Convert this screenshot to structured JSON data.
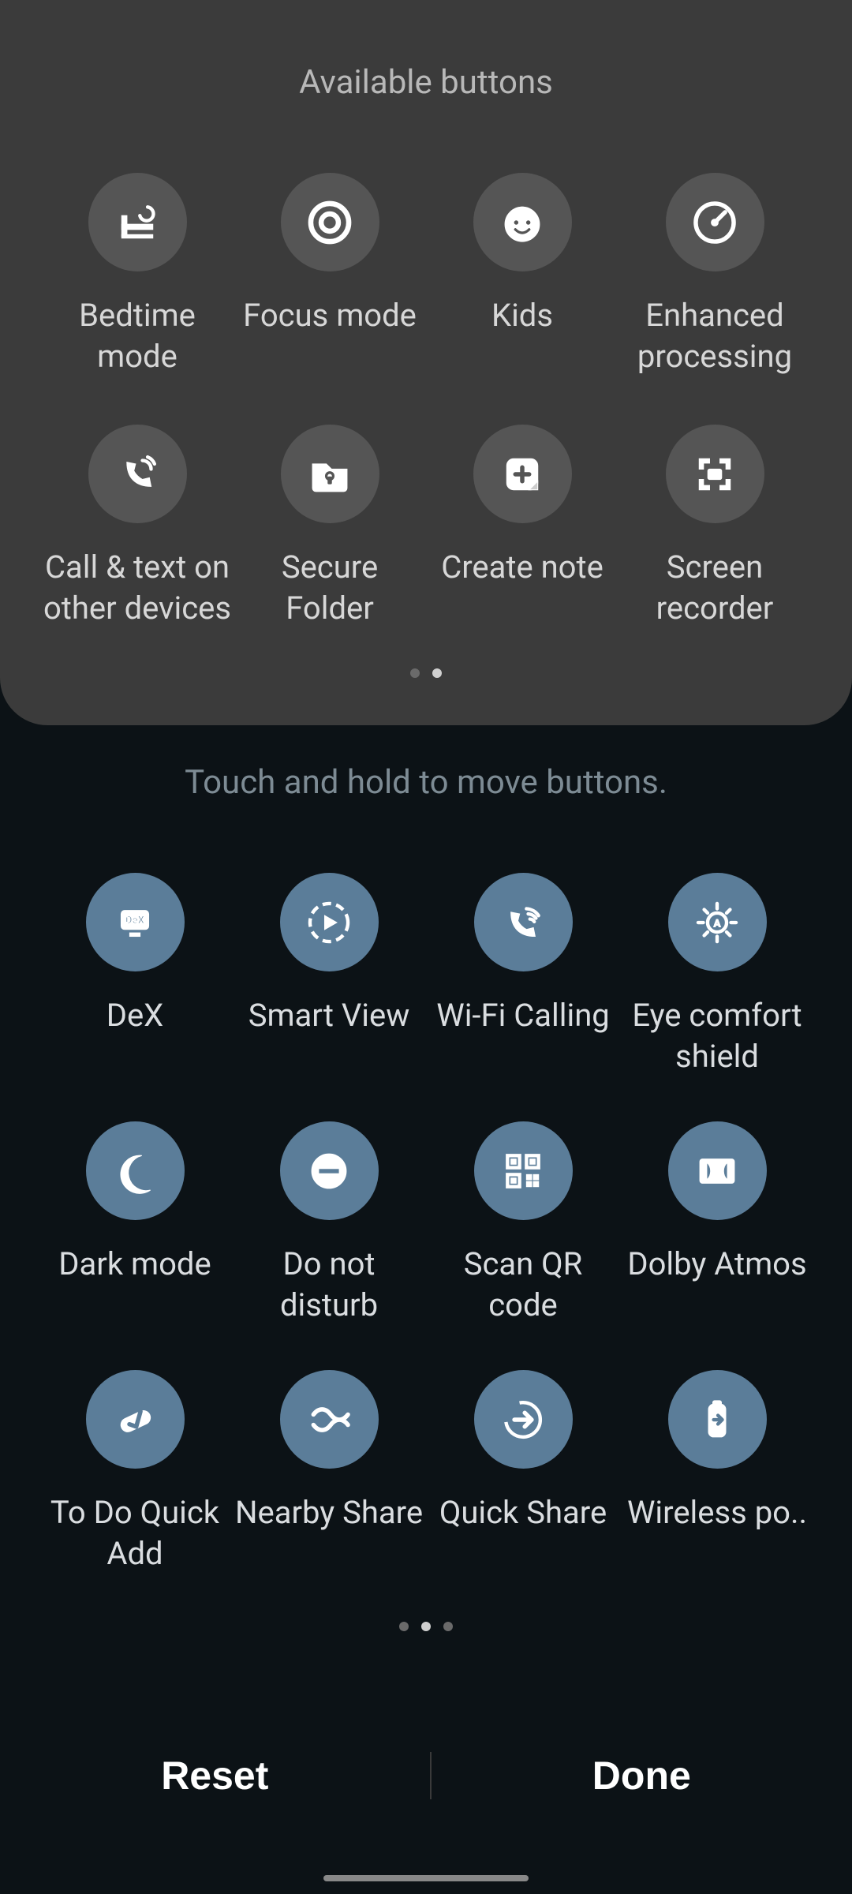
{
  "available": {
    "title": "Available buttons",
    "items": [
      {
        "label": "Bedtime mode",
        "icon": "bedtime-icon"
      },
      {
        "label": "Focus mode",
        "icon": "focus-icon"
      },
      {
        "label": "Kids",
        "icon": "kids-icon"
      },
      {
        "label": "Enhanced processing",
        "icon": "gauge-icon"
      },
      {
        "label": "Call & text on other devices",
        "icon": "call-sync-icon"
      },
      {
        "label": "Secure Folder",
        "icon": "secure-folder-icon"
      },
      {
        "label": "Create note",
        "icon": "create-note-icon"
      },
      {
        "label": "Screen recorder",
        "icon": "screen-recorder-icon"
      }
    ],
    "page_count": 2,
    "page_active": 1
  },
  "hint": "Touch and hold to move buttons.",
  "main": {
    "items": [
      {
        "label": "DeX",
        "icon": "dex-icon"
      },
      {
        "label": "Smart View",
        "icon": "smart-view-icon"
      },
      {
        "label": "Wi-Fi Calling",
        "icon": "wifi-calling-icon"
      },
      {
        "label": "Eye comfort shield",
        "icon": "eye-comfort-icon"
      },
      {
        "label": "Dark mode",
        "icon": "dark-mode-icon"
      },
      {
        "label": "Do not disturb",
        "icon": "dnd-icon"
      },
      {
        "label": "Scan QR code",
        "icon": "qr-icon"
      },
      {
        "label": "Dolby Atmos",
        "icon": "dolby-icon"
      },
      {
        "label": "To Do Quick Add",
        "icon": "todo-icon"
      },
      {
        "label": "Nearby Share",
        "icon": "nearby-share-icon"
      },
      {
        "label": "Quick Share",
        "icon": "quick-share-icon"
      },
      {
        "label": "Wireless po..",
        "icon": "wireless-power-icon"
      }
    ],
    "page_count": 3,
    "page_active": 1
  },
  "footer": {
    "reset_label": "Reset",
    "done_label": "Done"
  },
  "colors": {
    "available_circle": "#555555",
    "main_circle": "#5b7d99",
    "panel_bg": "#3b3b3b",
    "body_bg": "#0c1216"
  }
}
